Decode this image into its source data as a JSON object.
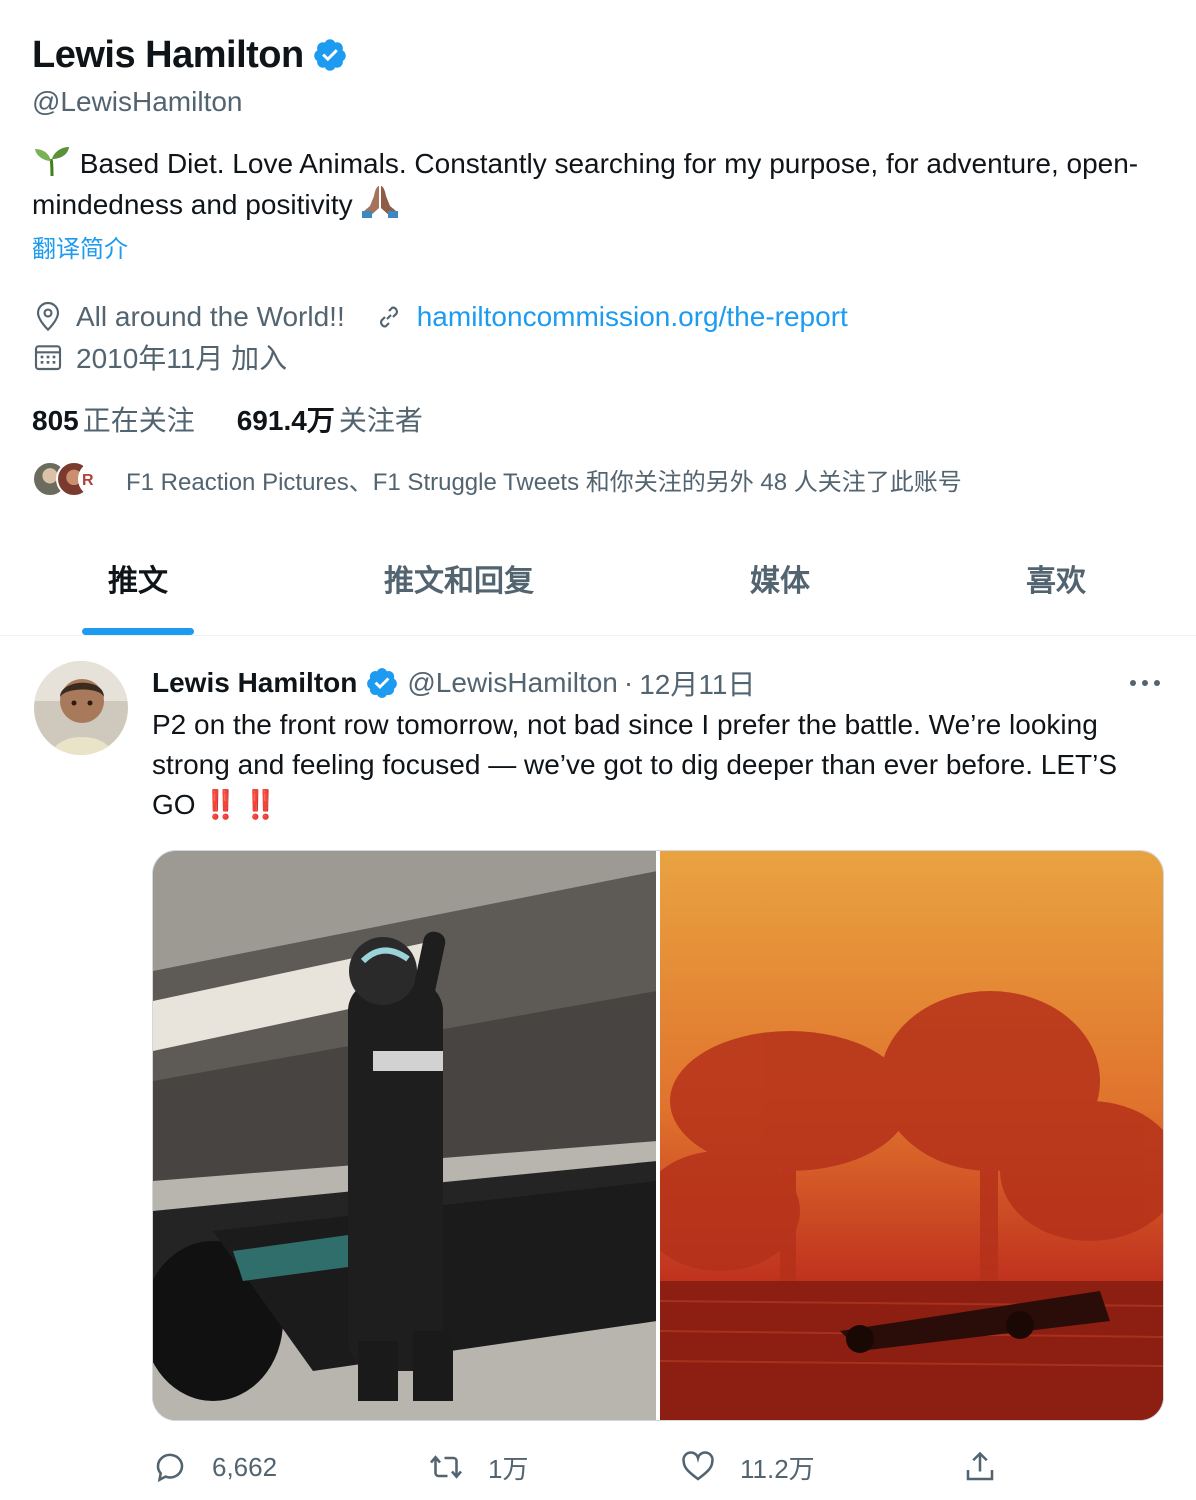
{
  "profile": {
    "name": "Lewis Hamilton",
    "handle": "@LewisHamilton",
    "bio_text": " Based Diet. Love Animals. Constantly searching for my purpose, for adventure, open-mindedness and positivity ",
    "translate_bio": "翻译简介",
    "location": "All around the World!!",
    "website": "hamiltoncommission.org/the-report",
    "joined": "2010年11月 加入",
    "following_count": "805",
    "following_label": "正在关注",
    "followers_count": "691.4万",
    "followers_label": "关注者",
    "followed_by_text": "F1 Reaction Pictures、F1 Struggle Tweets 和你关注的另外 48 人关注了此账号"
  },
  "tabs": [
    {
      "label": "推文",
      "active": true
    },
    {
      "label": "推文和回复",
      "active": false
    },
    {
      "label": "媒体",
      "active": false
    },
    {
      "label": "喜欢",
      "active": false
    }
  ],
  "tweet": {
    "author_name": "Lewis Hamilton",
    "author_handle": "@LewisHamilton",
    "separator": "·",
    "date": "12月11日",
    "text_before": "P2 on the front row tomorrow, not bad since I prefer the battle. We’re looking strong and feeling focused — we’ve got to dig deeper than ever before. LET’S GO ",
    "emoji_1": "‼️",
    "emoji_2": "‼️",
    "reply_count": "6,662",
    "retweet_count": "1万",
    "like_count": "11.2万"
  },
  "icons": {
    "verified": "verified-badge-icon",
    "location": "location-pin-icon",
    "link": "link-icon",
    "calendar": "calendar-icon",
    "more": "more-dots-icon",
    "reply": "reply-icon",
    "retweet": "retweet-icon",
    "like": "heart-icon",
    "share": "share-icon"
  },
  "colors": {
    "accent": "#1d9bf0",
    "text": "#0f1419",
    "secondary": "#536471",
    "border": "#eff3f4"
  }
}
